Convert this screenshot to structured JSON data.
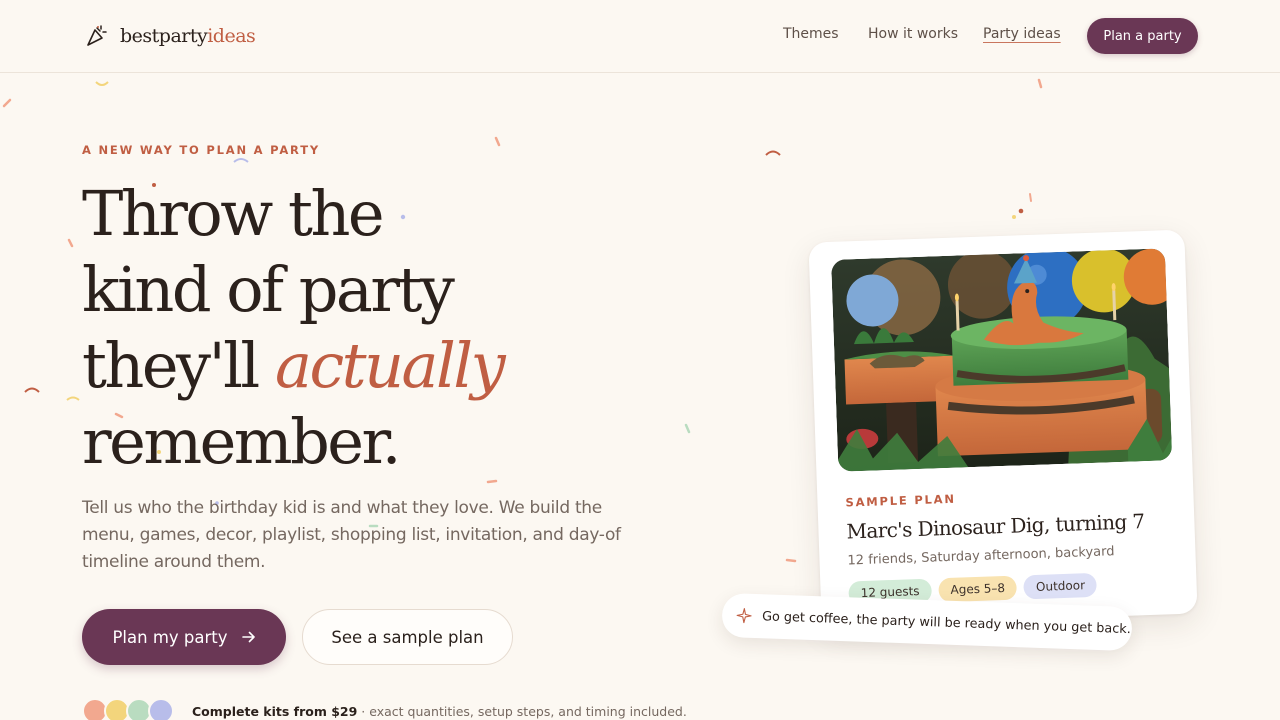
{
  "brand": {
    "name_part1": "bestparty",
    "name_part2": "ideas",
    "logo_icon": "party-popper-icon"
  },
  "nav": {
    "items": [
      {
        "label": "Themes"
      },
      {
        "label": "How it works"
      },
      {
        "label": "Party ideas",
        "active": true
      }
    ],
    "cta_label": "Plan a party"
  },
  "hero": {
    "eyebrow": "A NEW WAY TO PLAN A PARTY",
    "headline_line1": "Throw the",
    "headline_line2": "kind of party",
    "headline_line3_a": "they'll ",
    "headline_line3_b": "actually",
    "headline_line4": "remember.",
    "lede": "Tell us who the birthday kid is and what they love. We build the menu, games, decor, playlist, shopping list, invitation, and day-of timeline around them.",
    "primary_cta": "Plan my party",
    "primary_cta_icon": "arrow-right-icon",
    "secondary_cta": "See a sample plan",
    "proof_bold": "Complete kits from $29",
    "proof_rest": " · exact quantities, setup steps, and timing included.",
    "avatar_colors": [
      "#f2a88f",
      "#f3d57c",
      "#b9dcc0",
      "#b8bdea"
    ]
  },
  "sample_card": {
    "eyebrow": "SAMPLE PLAN",
    "title": "Marc's Dinosaur Dig, turning 7",
    "subtitle": "12 friends, Saturday afternoon, backyard",
    "tags": [
      {
        "label": "12 guests",
        "color": "#d3ecd8"
      },
      {
        "label": "Ages 5–8",
        "color": "#f9e3b0"
      },
      {
        "label": "Outdoor",
        "color": "#dde0f6"
      }
    ]
  },
  "note": {
    "icon": "sparkle-icon",
    "text": "Go get coffee, the party will be ready when you get back."
  },
  "colors": {
    "accent": "#c05e43",
    "primary": "#6a3755",
    "background": "#fcf8f2",
    "text": "#2b211c"
  }
}
